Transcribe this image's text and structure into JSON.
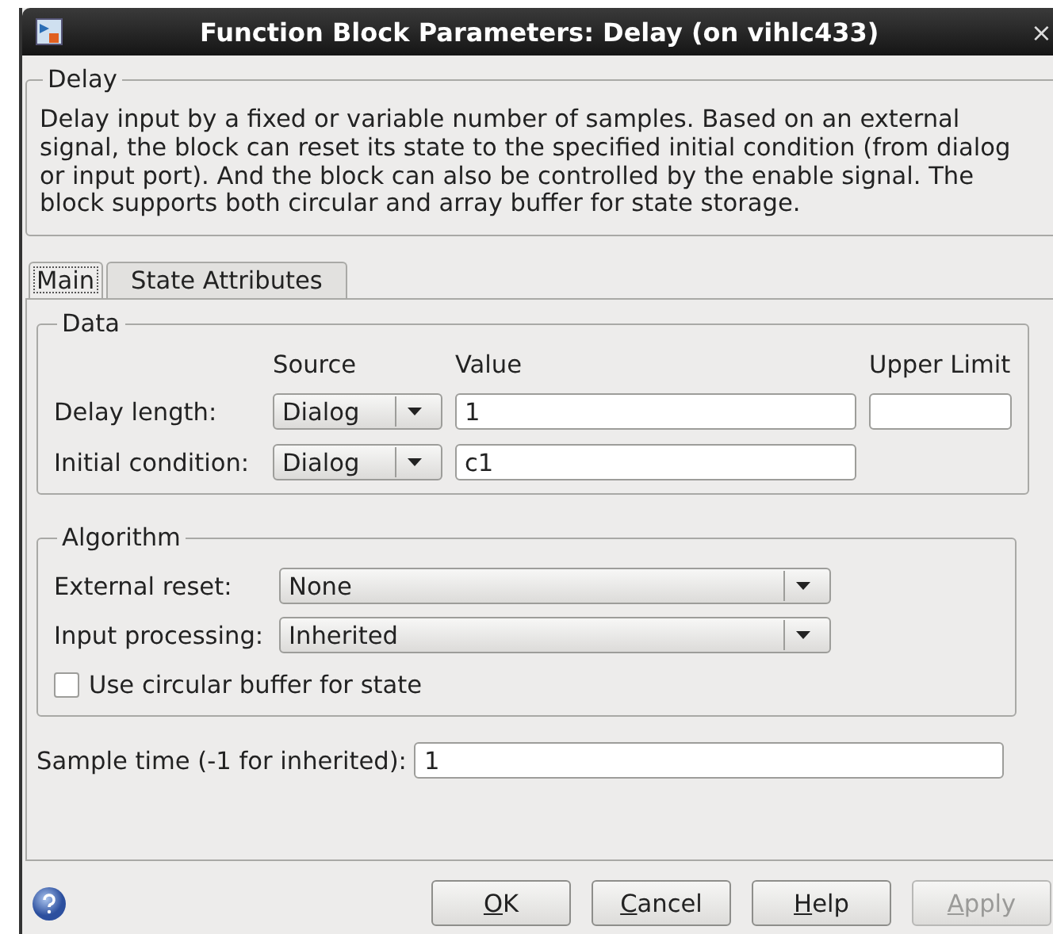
{
  "window": {
    "title": "Function Block Parameters: Delay (on vihlc433)",
    "close": "×"
  },
  "description_group": {
    "title": "Delay",
    "text": "Delay input by a fixed or variable number of samples. Based on an external signal, the block can reset its state to the specified initial condition (from dialog or input port). And the block can also be controlled by the enable signal. The block supports both circular and array buffer for state storage."
  },
  "tabs": [
    {
      "label": "Main",
      "selected": true
    },
    {
      "label": "State Attributes",
      "selected": false
    }
  ],
  "data_group": {
    "title": "Data",
    "columns": [
      "Source",
      "Value",
      "Upper Limit"
    ],
    "rows": [
      {
        "kind": "limited",
        "label": "Delay length:",
        "source": "Dialog",
        "value": "1"
      },
      {
        "kind": "plain",
        "label": "Initial condition:",
        "source": "Dialog",
        "value": "c1"
      }
    ]
  },
  "algorithm_group": {
    "title": "Algorithm",
    "dropdowns": [
      {
        "label": "External reset:",
        "value": "None"
      },
      {
        "label": "Input processing:",
        "value": "Inherited"
      }
    ],
    "checkbox": {
      "label": "Use circular buffer for state",
      "checked": false
    }
  },
  "sample_time": {
    "label": "Sample time (-1 for inherited):",
    "value": "1"
  },
  "buttons": [
    {
      "label": "OK",
      "disabled": false
    },
    {
      "label": "Cancel",
      "disabled": false
    },
    {
      "label": "Help",
      "disabled": false
    },
    {
      "label": "Apply",
      "disabled": true
    }
  ]
}
